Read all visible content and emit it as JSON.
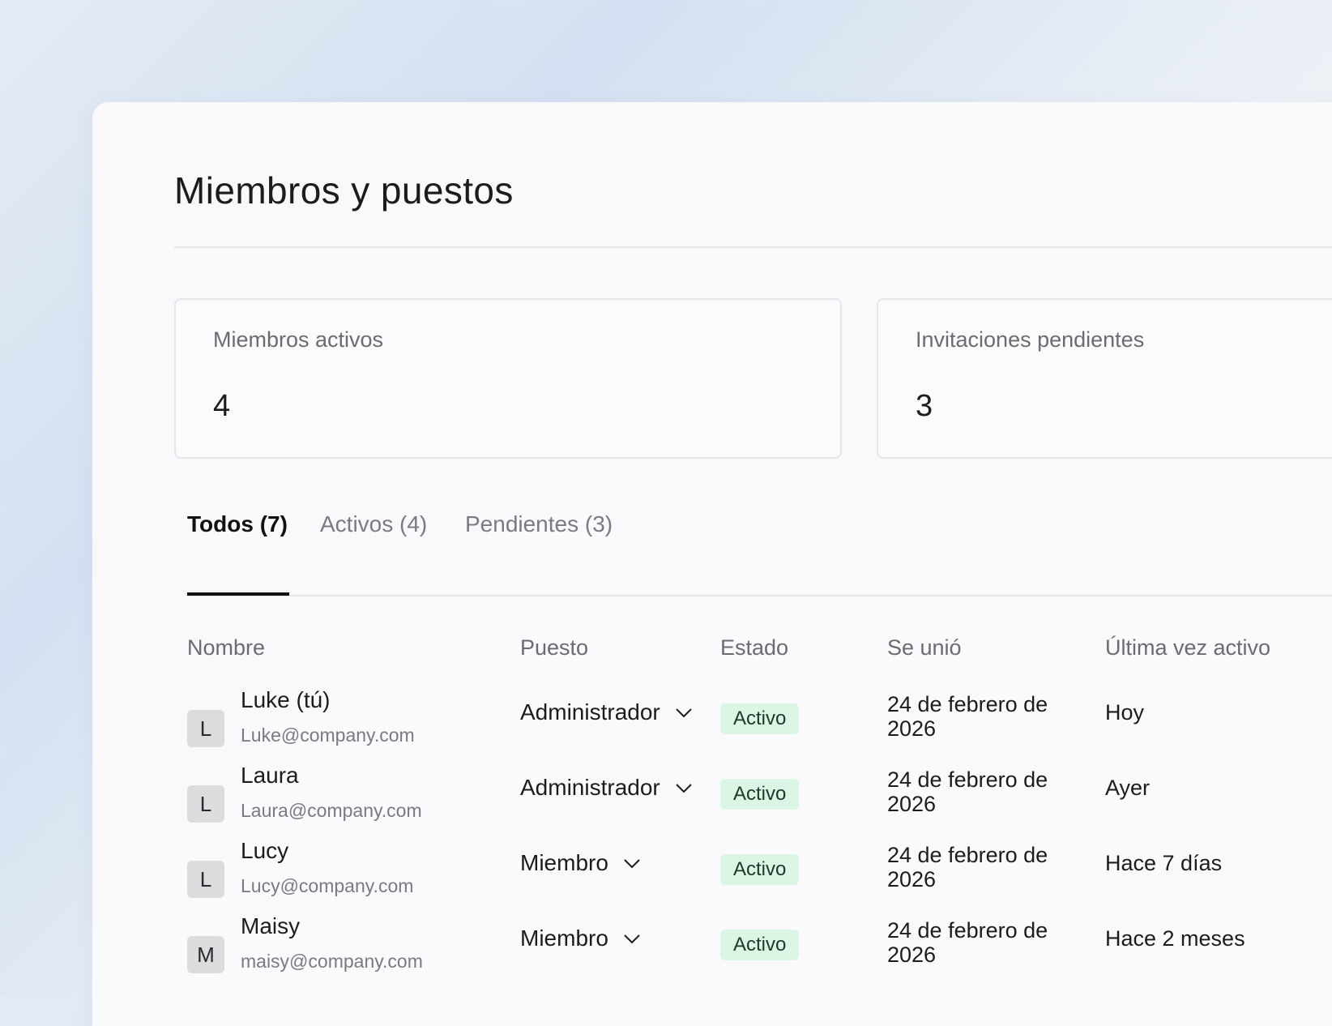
{
  "page": {
    "title": "Miembros y puestos"
  },
  "stats": [
    {
      "label": "Miembros activos",
      "value": "4"
    },
    {
      "label": "Invitaciones pendientes",
      "value": "3"
    }
  ],
  "tabs": [
    {
      "label": "Todos (7)",
      "selected": true
    },
    {
      "label": "Activos (4)",
      "selected": false
    },
    {
      "label": "Pendientes (3)",
      "selected": false
    }
  ],
  "table": {
    "columns": [
      "Nombre",
      "Puesto",
      "Estado",
      "Se unió",
      "Última vez activo"
    ],
    "rows": [
      {
        "initial": "L",
        "name": "Luke (tú)",
        "email": "Luke@company.com",
        "role": "Administrador",
        "status": "Activo",
        "joined": "24 de febrero de 2026",
        "last_active": "Hoy"
      },
      {
        "initial": "L",
        "name": "Laura",
        "email": "Laura@company.com",
        "role": "Administrador",
        "status": "Activo",
        "joined": "24 de febrero de 2026",
        "last_active": "Ayer"
      },
      {
        "initial": "L",
        "name": "Lucy",
        "email": "Lucy@company.com",
        "role": "Miembro",
        "status": "Activo",
        "joined": "24 de febrero de 2026",
        "last_active": "Hace 7 días"
      },
      {
        "initial": "M",
        "name": "Maisy",
        "email": "maisy@company.com",
        "role": "Miembro",
        "status": "Activo",
        "joined": "24 de febrero de 2026",
        "last_active": "Hace 2 meses"
      }
    ]
  },
  "icons": {
    "role_dropdown": "chevron-down-icon"
  },
  "colors": {
    "status_active_bg": "#dcf6e6",
    "tab_selected": "#111111",
    "muted_text": "#6b6b70"
  }
}
